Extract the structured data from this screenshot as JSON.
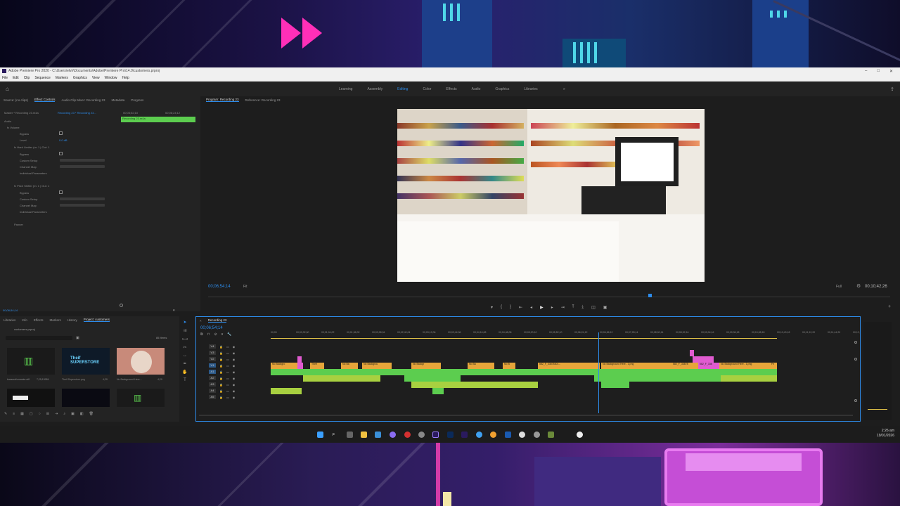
{
  "window": {
    "title": "Adobe Premiere Pro 2020 - C:\\Users\\elvir\\Documents\\Adobe\\Premiere Pro\\14.0\\customers.prproj",
    "controls": [
      "–",
      "□",
      "✕"
    ]
  },
  "menu": [
    "File",
    "Edit",
    "Clip",
    "Sequence",
    "Markers",
    "Graphics",
    "View",
    "Window",
    "Help"
  ],
  "workspaces": {
    "tabs": [
      "Learning",
      "Assembly",
      "Editing",
      "Color",
      "Effects",
      "Audio",
      "Graphics",
      "Libraries"
    ],
    "active": "Editing",
    "more": "»"
  },
  "effect_controls": {
    "tabs": [
      "Source: (no clips)",
      "Effect Controls",
      "Audio Clip Mixer: Recording 23",
      "Metadata",
      "Progress"
    ],
    "active_tab": "Effect Controls",
    "master": "Master * Recording 23.m4a",
    "clip": "Recording 23 * Recording 23...",
    "tc_in": "00;05;52;10",
    "tc_out": "00;06;24;12",
    "clip_bar_label": "Recording 23.m4a",
    "rows": [
      "Audio",
      "fx Volume",
      "Bypass",
      "Level",
      "fx Hard Limiter (m: 1 | Out: 1",
      "Bypass",
      "Custom Setup",
      "Channel Map",
      "Individual Parameters",
      "fx Pitch Shifter (m: 1 | Out: 1",
      "Bypass",
      "Custom Setup",
      "Channel Map",
      "Individual Parameters",
      "Panner"
    ],
    "level_value": "0.0 dB",
    "edit_label": "Edit...",
    "remap_label": "Remap...",
    "footer_tc": "00;06;54;14"
  },
  "program_monitor": {
    "tabs": [
      "Program: Recording 23",
      "Reference: Recording 23"
    ],
    "active_tab": "Program: Recording 23",
    "timecode": "00;06;54;14",
    "fit": "Fit",
    "quality": "Full",
    "duration": "00;10;42;26"
  },
  "project_panel": {
    "tabs": [
      "Libraries",
      "Info",
      "Effects",
      "Markers",
      "History",
      "Project: customers"
    ],
    "active_tab": "Project: customers",
    "project_file": "customers.prproj",
    "item_count": "85 Items",
    "items": [
      {
        "name": "bassaudiomaster.aiff",
        "duration": "7;25;15984"
      },
      {
        "name": "Theif Superstore.png",
        "duration": "4;29"
      },
      {
        "name": "No Background Here...",
        "duration": "4;29"
      }
    ],
    "thumb_text": "Theif SUPERSTORE"
  },
  "timeline": {
    "tab": "Recording 23",
    "timecode": "00;06;54;14",
    "ruler": [
      "00;00",
      "00;00;32;00",
      "00;01;04;02",
      "00;01;36;02",
      "00;02;08;04",
      "00;02;40;04",
      "00;03;12;06",
      "00;03;44;06",
      "00;04;16;08",
      "00;04;48;08",
      "00;05;20;10",
      "00;05;52;10",
      "00;06;24;12",
      "00;06;56;12",
      "00;07;28;14",
      "00;08;00;14",
      "00;08;32;16",
      "00;09;04;16",
      "00;09;36;18",
      "00;10;08;18",
      "00;10;40;18",
      "00;11;12;20",
      "00;11;44;20",
      "00;12;"
    ],
    "video_tracks": [
      "V4",
      "V3",
      "V2",
      "V1"
    ],
    "audio_tracks": [
      "A1",
      "A2",
      "A3",
      "A4",
      "A5"
    ],
    "clip_labels": [
      "No Backgro",
      "Theif",
      "No Ba",
      "No Backgrou",
      "No Backgr",
      "No Ba",
      "No B",
      "582_F_33878301...",
      "No Background Here.. 1.png",
      "582_F_33878",
      "582_F_338",
      "No Background Here.. 1.png",
      "Fe"
    ]
  },
  "taskbar": {
    "time": "2:26 am",
    "date": "19/01/2026"
  },
  "colors": {
    "accent": "#2d8ceb",
    "video_clip": "#e6a53a",
    "audio_clip": "#5ccd4f",
    "pink_clip": "#e05bd0",
    "panel_bg": "#232323"
  }
}
